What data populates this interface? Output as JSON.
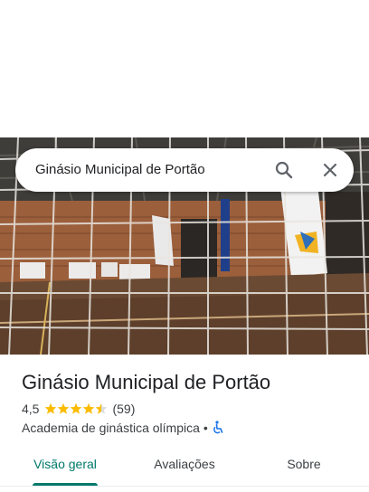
{
  "search": {
    "query": "Ginásio Municipal de Portão"
  },
  "place": {
    "title": "Ginásio Municipal de Portão",
    "rating": "4,5",
    "rating_value": 4.5,
    "review_count": "(59)",
    "category": "Academia de ginástica olímpica",
    "separator": "•",
    "accessibility_icon": "wheelchair-icon"
  },
  "tabs": {
    "overview": "Visão geral",
    "reviews": "Avaliações",
    "about": "Sobre"
  },
  "colors": {
    "accent": "#00796b",
    "star": "#fbbc04",
    "accessibility": "#1a73e8"
  }
}
